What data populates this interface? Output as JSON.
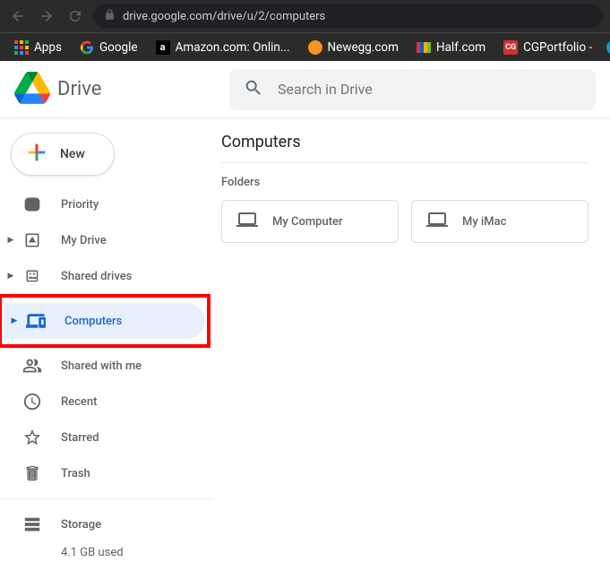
{
  "browser": {
    "url": "drive.google.com/drive/u/2/computers",
    "bookmarks": [
      {
        "label": "Apps",
        "icon": "apps"
      },
      {
        "label": "Google",
        "icon": "google"
      },
      {
        "label": "Amazon.com: Onlin...",
        "icon": "amazon"
      },
      {
        "label": "Newegg.com",
        "icon": "newegg"
      },
      {
        "label": "Half.com",
        "icon": "half"
      },
      {
        "label": "CGPortfolio -",
        "icon": "cg"
      }
    ]
  },
  "header": {
    "logo_text": "Drive",
    "search_placeholder": "Search in Drive"
  },
  "sidebar": {
    "new_label": "New",
    "items": [
      {
        "label": "Priority",
        "expandable": false
      },
      {
        "label": "My Drive",
        "expandable": true
      },
      {
        "label": "Shared drives",
        "expandable": true
      },
      {
        "label": "Computers",
        "expandable": true,
        "active": true
      },
      {
        "label": "Shared with me",
        "expandable": false
      },
      {
        "label": "Recent",
        "expandable": false
      },
      {
        "label": "Starred",
        "expandable": false
      },
      {
        "label": "Trash",
        "expandable": false
      }
    ],
    "storage_label": "Storage",
    "storage_used": "4.1 GB used"
  },
  "content": {
    "title": "Computers",
    "section_label": "Folders",
    "folders": [
      {
        "name": "My Computer"
      },
      {
        "name": "My iMac"
      }
    ]
  }
}
